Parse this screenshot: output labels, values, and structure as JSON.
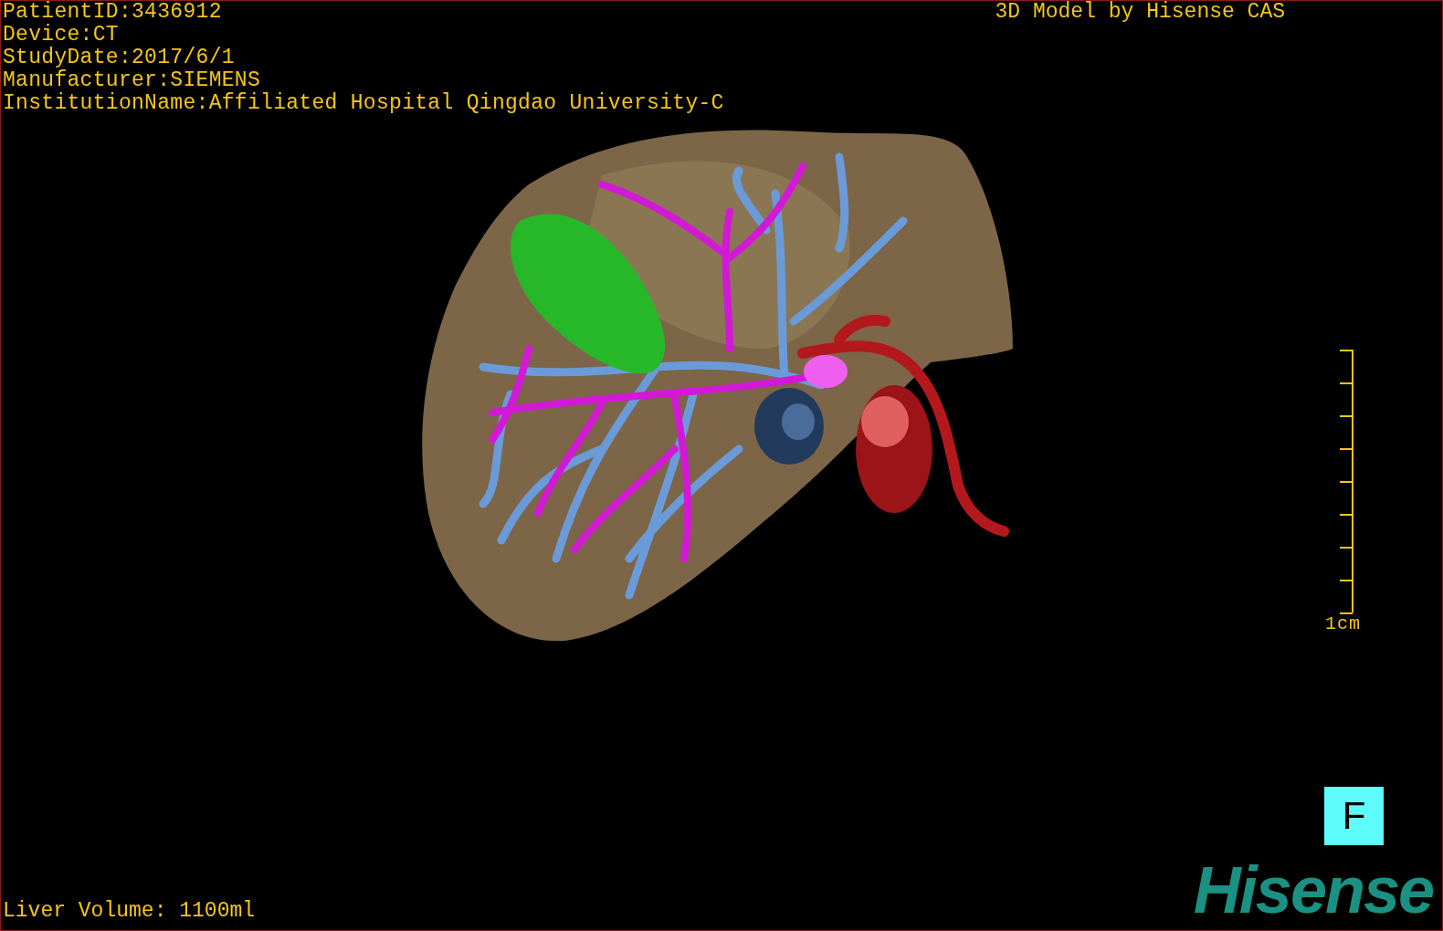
{
  "patient_info": [
    "PatientID:3436912",
    "Device:CT",
    "StudyDate:2017/6/1",
    "Manufacturer:SIEMENS",
    "InstitutionName:Affiliated Hospital Qingdao University-C"
  ],
  "credit": "3D Model by Hisense CAS",
  "scale_bar": {
    "label": "1cm"
  },
  "orientation_marker": "F",
  "liver_volume": "Liver Volume: 1100ml",
  "logo": "Hisense"
}
